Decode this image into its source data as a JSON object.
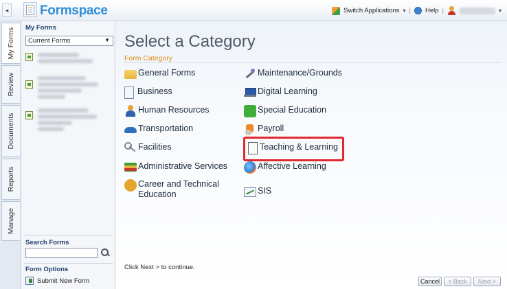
{
  "app": {
    "title": "Formspace"
  },
  "header": {
    "switch_apps_label": "Switch Applications",
    "help_label": "Help"
  },
  "vertical_tabs": [
    "My Forms",
    "Review",
    "Documents",
    "Reports",
    "Manage"
  ],
  "left_panel": {
    "my_forms_heading": "My Forms",
    "forms_filter_selected": "Current Forms",
    "search_heading": "Search Forms",
    "search_value": "",
    "form_options_heading": "Form Options",
    "submit_new_form_label": "Submit New Form"
  },
  "main": {
    "page_title": "Select a Category",
    "section_label": "Form Category",
    "categories_left": [
      {
        "label": "General Forms",
        "icon": "folder-icon"
      },
      {
        "label": "Business",
        "icon": "document-icon"
      },
      {
        "label": "Human Resources",
        "icon": "person-icon"
      },
      {
        "label": "Transportation",
        "icon": "car-icon"
      },
      {
        "label": "Facilities",
        "icon": "key-icon"
      },
      {
        "label": "Administrative Services",
        "icon": "books-icon"
      },
      {
        "label": "Career and Technical Education",
        "icon": "pot-icon"
      }
    ],
    "categories_right": [
      {
        "label": "Maintenance/Grounds",
        "icon": "wrench-icon"
      },
      {
        "label": "Digital Learning",
        "icon": "laptop-icon"
      },
      {
        "label": "Special Education",
        "icon": "puzzle-icon"
      },
      {
        "label": "Payroll",
        "icon": "money-icon"
      },
      {
        "label": "Teaching & Learning",
        "icon": "book-icon",
        "highlighted": true
      },
      {
        "label": "Affective Learning",
        "icon": "globe-icon"
      },
      {
        "label": "SIS",
        "icon": "chart-icon"
      }
    ],
    "hint": "Click Next > to continue.",
    "buttons": {
      "cancel": "Cancel",
      "back": "< Back",
      "next": "Next >"
    }
  },
  "colors": {
    "brand": "#2f8fd6",
    "section_label": "#e08a1e",
    "highlight": "#e0282f"
  }
}
